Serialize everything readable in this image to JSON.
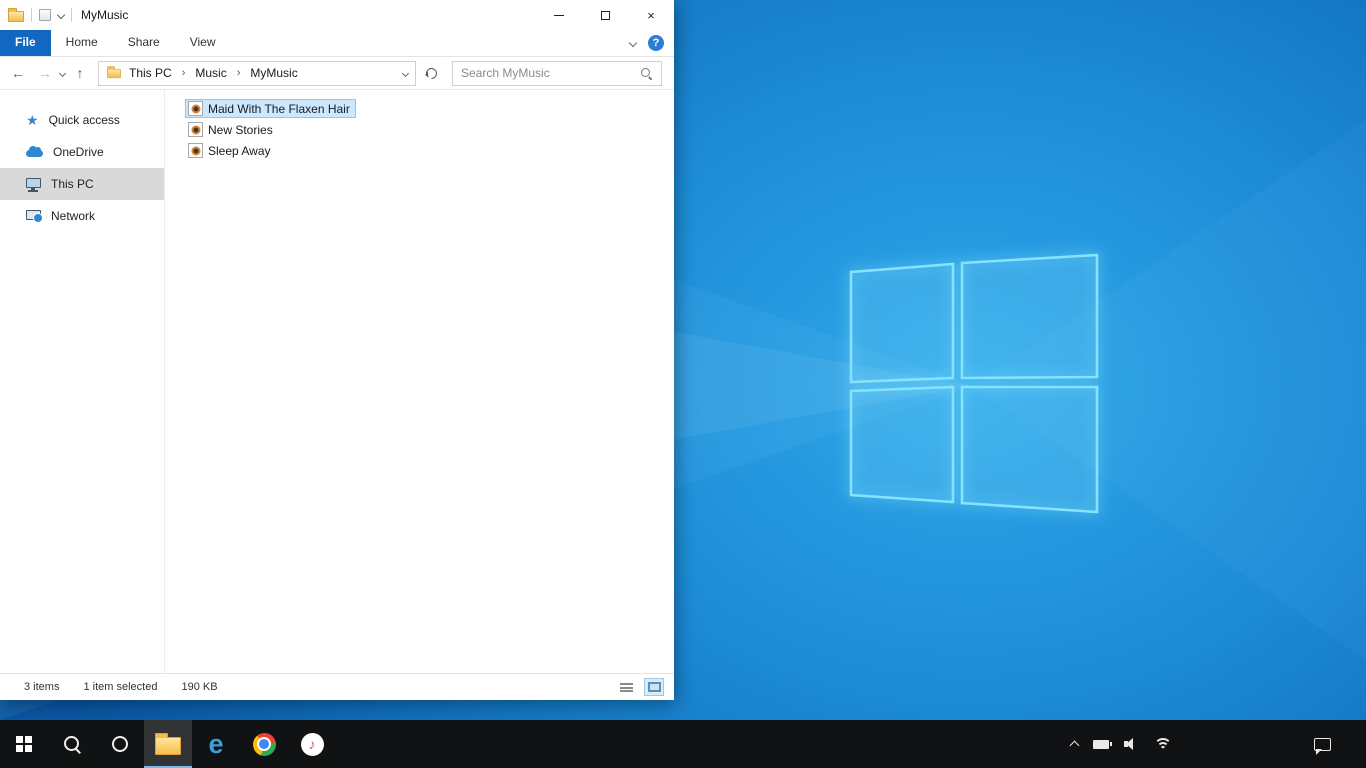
{
  "colors": {
    "accent_blue": "#1267c1",
    "selection_fill": "#cce8ff",
    "selection_border": "#8fc6f0",
    "sidebar_selected": "#d9d9d9",
    "taskbar_background": "#101214",
    "desktop_blue": "#1c8ad6",
    "logo_glow": "#86e3ff"
  },
  "glyphs": {
    "close": "×",
    "star": "★",
    "edge_e": "e",
    "music_note": "♪"
  },
  "explorer": {
    "title": "MyMusic",
    "ribbon": {
      "tabs": [
        {
          "label": "File"
        },
        {
          "label": "Home"
        },
        {
          "label": "Share"
        },
        {
          "label": "View"
        }
      ],
      "help": "?"
    },
    "navigation": {
      "back": "←",
      "forward": "→",
      "up": "↑",
      "breadcrumb": {
        "separator": "›",
        "items": [
          "This PC",
          "Music",
          "MyMusic"
        ]
      },
      "search_placeholder": "Search MyMusic"
    },
    "sidebar": {
      "items": [
        {
          "label": "Quick access",
          "icon": "star-icon",
          "selected": false
        },
        {
          "label": "OneDrive",
          "icon": "cloud-icon",
          "selected": false
        },
        {
          "label": "This PC",
          "icon": "computer-icon",
          "selected": true
        },
        {
          "label": "Network",
          "icon": "network-icon",
          "selected": false
        }
      ]
    },
    "files": [
      {
        "name": "Maid With The Flaxen Hair",
        "icon": "music-file-icon",
        "selected": true
      },
      {
        "name": "New Stories",
        "icon": "music-file-icon",
        "selected": false
      },
      {
        "name": "Sleep Away",
        "icon": "music-file-icon",
        "selected": false
      }
    ],
    "statusbar": {
      "count": "3 items",
      "selected": "1 item selected",
      "size": "190 KB"
    }
  },
  "taskbar": {
    "buttons": [
      "start",
      "search",
      "cortana",
      "file-explorer",
      "edge",
      "chrome",
      "itunes"
    ],
    "active_button": "file-explorer",
    "tray": [
      "hidden-icons-chevron",
      "battery",
      "volume",
      "wifi",
      "action-center"
    ]
  }
}
